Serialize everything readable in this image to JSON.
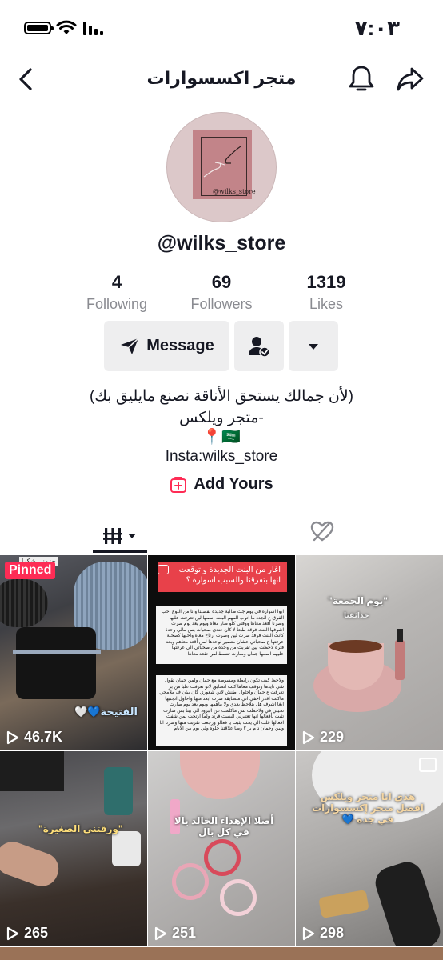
{
  "status": {
    "time": "٧:٠٣"
  },
  "header": {
    "title": "متجر اكسسوارات",
    "back_icon": "chevron-left-icon",
    "bell_icon": "bell-icon",
    "share_icon": "share-icon"
  },
  "profile": {
    "avatar_text": "@wilks_store",
    "username": "@wilks_store",
    "stats": {
      "following": {
        "value": "4",
        "label": "Following"
      },
      "followers": {
        "value": "69",
        "label": "Followers"
      },
      "likes": {
        "value": "1319",
        "label": "Likes"
      }
    },
    "buttons": {
      "message": "Message"
    },
    "bio": {
      "line1": "(لأن جمالك يستحق الأناقة نصنع مايليق بك)",
      "line2": "-متجر ويلكس",
      "line3": "📍🇸🇦",
      "line4": "Insta:wilks_store"
    },
    "add_yours": "Add Yours"
  },
  "tabs": {
    "active": "videos"
  },
  "videos": [
    {
      "views": "46.7K",
      "pinned": "Pinned",
      "caption": "الفتيحة💙🤍",
      "top_caption": "حزمني شكرا"
    },
    {
      "views": "",
      "banner": "اغار من البنت الجديدة و توقعت انها بتفرقنا والسبب اسوارة ؟",
      "body1": "ابوا اسوارة في يوم جت طالبة جديدة لفصلنا وانا من النوع احب الفرق ع الجدد ما اتوب المهم البنت اسمها لين تعرفت عليها وصرنا أقعد معاها ووقتي كلو صار معاه ويوم بعد يوم صرت اشوفها البنت فرقد طبعا لا كان عندي صحبات بس مالي وحدة كانت البنت فرقد صرت لين وصرت ارتاح معاه واحبها كصحبة عرفتها ع صحباتي عشان متصير لوحدها لمن أقعد معاهم وبعد فترة لاحظت لين تقربت من وحدة من صحباتي الي عرفتها عليهم اسمها جمان وصارت تنسط لمن تقعد معاها",
      "body2": "ولاحظ كيف تكون رابطة ومسوطة مع جمان ولمن جمان تقول شي تايدها وتوقف معاها كنت اتضايق لانو تعرفت علبا من بر تعرفت ع جمان واحاول اطنش لانن شعوري كان يبان ف ملامحي ماكنت اقدر اخفي اني متضايقة صرت ابعد منها واحاول اتجنبها ابغا اشوف هل بتلاحظ بعدي ولا ماهمها ويوم بعد يوم صارت تجيني في ولاحظت بس ماكلمت عن البرود الي بينا بس صارت تثبت بأفعالها انها تعتبرني البست فرند ولما ارتحت لمن شفت افعالها قلت الي يحب يثبت يا فعالو ورجعت تقربت منها وصرنا انا ولين وجمان د م بر ٢ وصا علاقتنا حلوه ولي يوم من الايام"
    },
    {
      "views": "229",
      "caption": "\"يوم الجمعة\"",
      "subcaption": "حدائقنا"
    },
    {
      "views": "265",
      "caption": "\"ورقتني الصغيرة\""
    },
    {
      "views": "251",
      "caption": "أصلا الإهداء الخالد يالا في كل بال"
    },
    {
      "views": "298",
      "caption": "هذي انا متجر ويلكس افضل متجر إكسسوارات في جدة 💙"
    }
  ]
}
